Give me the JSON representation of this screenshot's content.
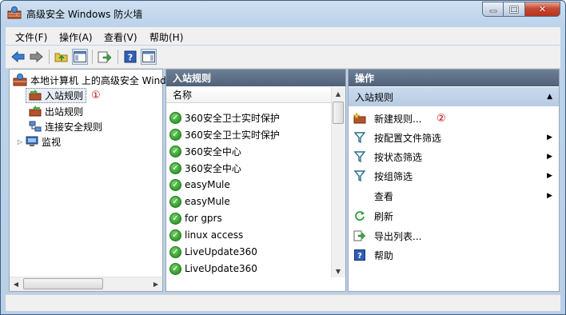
{
  "window": {
    "title": "高级安全 Windows 防火墙",
    "controls": [
      "minimize",
      "maximize",
      "close"
    ]
  },
  "menu": [
    "文件(F)",
    "操作(A)",
    "查看(V)",
    "帮助(H)"
  ],
  "toolbar": {
    "icons": [
      "back-icon",
      "forward-icon",
      "folder-up-icon",
      "console-tree-icon",
      "export-icon",
      "help-icon",
      "action-pane-icon"
    ]
  },
  "tree": {
    "root": "本地计算机 上的高级安全 Windows 防火墙",
    "root_visible": "本地计算机 上的高级安全 Wind",
    "items": [
      {
        "label": "入站规则",
        "selected": true,
        "marker": "①"
      },
      {
        "label": "出站规则"
      },
      {
        "label": "连接安全规则"
      },
      {
        "label": "监视",
        "expandable": true
      }
    ]
  },
  "rules_pane": {
    "header": "入站规则",
    "column": "名称",
    "rows": [
      "360安全卫士实时保护",
      "360安全卫士实时保护",
      "360安全中心",
      "360安全中心",
      "easyMule",
      "easyMule",
      "for gprs",
      "linux access",
      "LiveUpdate360",
      "LiveUpdate360"
    ]
  },
  "actions_pane": {
    "header": "操作",
    "section": "入站规则",
    "items": [
      {
        "label": "新建规则...",
        "icon": "new-rule-icon",
        "marker": "②"
      },
      {
        "label": "按配置文件筛选",
        "icon": "filter-icon",
        "submenu": true
      },
      {
        "label": "按状态筛选",
        "icon": "filter-icon",
        "submenu": true
      },
      {
        "label": "按组筛选",
        "icon": "filter-icon",
        "submenu": true
      },
      {
        "label": "查看",
        "icon": "",
        "submenu": true
      },
      {
        "label": "刷新",
        "icon": "refresh-icon"
      },
      {
        "label": "导出列表...",
        "icon": "export-list-icon"
      },
      {
        "label": "帮助",
        "icon": "help-icon"
      }
    ]
  },
  "colors": {
    "pane_header": "#5a6d84",
    "section_bg": "#c0d4ea",
    "annotation": "#c00000",
    "check_green": "#2f9a2a"
  }
}
